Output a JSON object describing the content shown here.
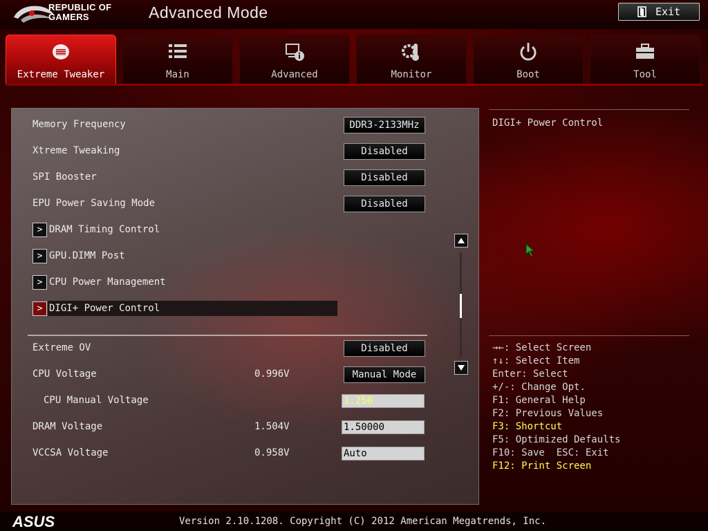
{
  "header": {
    "brand_line1": "REPUBLIC OF",
    "brand_line2": "GAMERS",
    "mode_title": "Advanced Mode",
    "exit_label": "Exit"
  },
  "tabs": [
    {
      "label": "Extreme Tweaker",
      "icon": "tweaker-icon",
      "active": true
    },
    {
      "label": "Main",
      "icon": "list-icon",
      "active": false
    },
    {
      "label": "Advanced",
      "icon": "advanced-info-icon",
      "active": false
    },
    {
      "label": "Monitor",
      "icon": "thermometer-gear-icon",
      "active": false
    },
    {
      "label": "Boot",
      "icon": "power-icon",
      "active": false
    },
    {
      "label": "Tool",
      "icon": "toolbox-icon",
      "active": false
    }
  ],
  "settings_top": [
    {
      "label": "Memory Frequency",
      "value": "DDR3-2133MHz"
    },
    {
      "label": "Xtreme Tweaking",
      "value": "Disabled"
    },
    {
      "label": "SPI Booster",
      "value": "Disabled"
    },
    {
      "label": "EPU Power Saving Mode",
      "value": "Disabled"
    }
  ],
  "submenus": [
    {
      "label": "DRAM Timing Control"
    },
    {
      "label": "GPU.DIMM Post"
    },
    {
      "label": "CPU Power Management"
    },
    {
      "label": "DIGI+ Power Control"
    }
  ],
  "settings_bottom": {
    "extreme_ov": {
      "label": "Extreme OV",
      "value": "Disabled"
    },
    "cpu_voltage": {
      "label": "CPU Voltage",
      "reading": "0.996V",
      "value": "Manual Mode"
    },
    "cpu_manual_voltage": {
      "label": "CPU Manual Voltage",
      "value": "1.250"
    },
    "dram_voltage": {
      "label": "DRAM Voltage",
      "reading": "1.504V",
      "value": "1.50000"
    },
    "vccsa_voltage": {
      "label": "VCCSA Voltage",
      "reading": "0.958V",
      "value": "Auto"
    }
  },
  "help": {
    "title": "DIGI+ Power Control",
    "keys": [
      "→←: Select Screen",
      "↑↓: Select Item",
      "Enter: Select",
      "+/-: Change Opt.",
      "F1: General Help",
      "F2: Previous Values",
      "F3: Shortcut",
      "F5: Optimized Defaults",
      "F10: Save  ESC: Exit",
      "F12: Print Screen"
    ]
  },
  "footer": {
    "brand": "ASUS",
    "version": "Version 2.10.1208. Copyright (C) 2012 American Megatrends, Inc."
  },
  "colors": {
    "accent_red": "#d01010",
    "highlight_yellow": "#ffff55"
  }
}
